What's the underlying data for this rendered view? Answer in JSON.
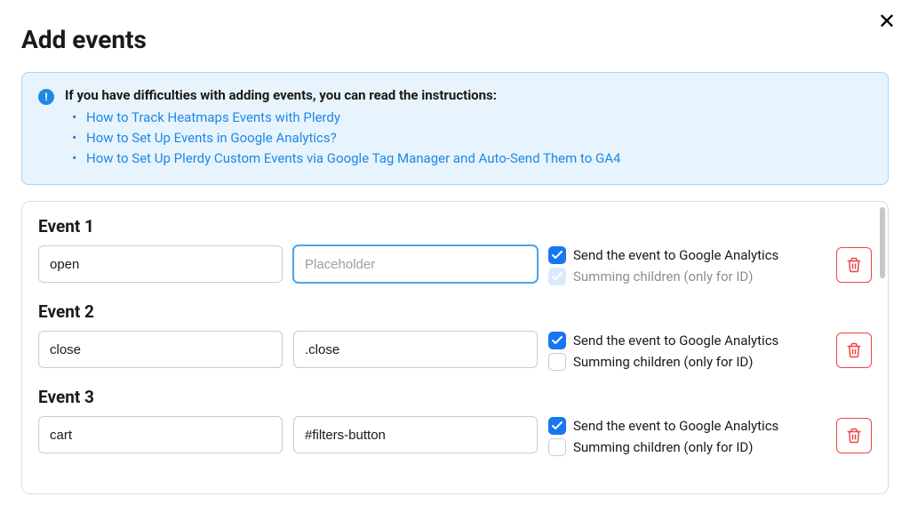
{
  "page_title": "Add events",
  "close_icon": "✕",
  "info": {
    "heading": "If you have difficulties with adding events, you can read the instructions:",
    "links": [
      "How to Track Heatmaps Events with Plerdy",
      "How to Set Up Events in Google Analytics?",
      "How to Set Up Plerdy Custom Events via Google Tag Manager and Auto-Send Them to GA4"
    ]
  },
  "labels": {
    "ga": "Send the event to Google Analytics",
    "summing": "Summing children (only for ID)",
    "placeholder": "Placeholder"
  },
  "events": [
    {
      "title": "Event 1",
      "name_value": "open",
      "selector_value": "",
      "selector_focused": true,
      "ga_checked": true,
      "summing_checked": true,
      "summing_disabled": true
    },
    {
      "title": "Event 2",
      "name_value": "close",
      "selector_value": ".close",
      "selector_focused": false,
      "ga_checked": true,
      "summing_checked": false,
      "summing_disabled": false
    },
    {
      "title": "Event 3",
      "name_value": "cart",
      "selector_value": "#filters-button",
      "selector_focused": false,
      "ga_checked": true,
      "summing_checked": false,
      "summing_disabled": false
    }
  ]
}
